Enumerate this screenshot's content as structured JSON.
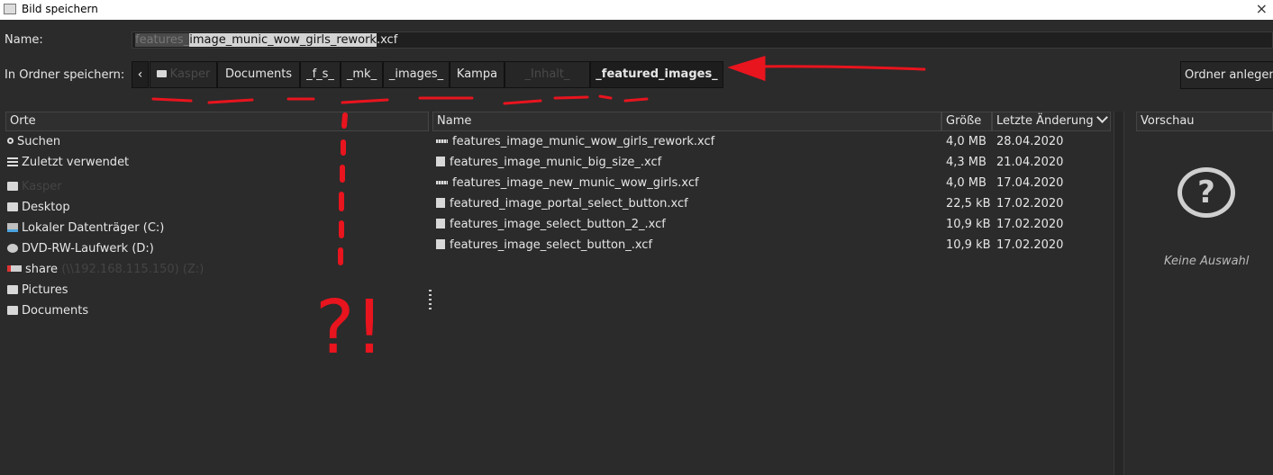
{
  "window": {
    "title": "Bild speichern",
    "close": "×"
  },
  "name_row": {
    "label": "Name:",
    "value_dim": "features_",
    "value_selected": "image_munic_wow_girls_rework",
    "value_ext": ".xcf"
  },
  "folder_row": {
    "label": "In Ordner speichern:",
    "back": "‹",
    "crumbs": [
      "Kasper",
      "Documents",
      "_f_s_",
      "_mk_",
      "_images_",
      "Kampa",
      "_Inhalt_",
      "_featured_images_"
    ],
    "new_folder": "Ordner anlegen"
  },
  "places": {
    "header": "Orte",
    "items": [
      {
        "label": "Suchen",
        "icon": "search-icon"
      },
      {
        "label": "Zuletzt verwendet",
        "icon": "recent-icon"
      },
      {
        "label": "Kasper",
        "icon": "folder-icon"
      },
      {
        "label": "Desktop",
        "icon": "folder-icon"
      },
      {
        "label": "Lokaler Datenträger (C:)",
        "icon": "drive-icon"
      },
      {
        "label": "DVD-RW-Laufwerk (D:)",
        "icon": "dvd-icon"
      },
      {
        "label": "share",
        "suffix": "(\\\\192.168.115.150) (Z:)",
        "icon": "share-icon"
      },
      {
        "label": "Pictures",
        "icon": "folder-icon"
      },
      {
        "label": "Documents",
        "icon": "folder-icon"
      }
    ]
  },
  "files": {
    "headers": {
      "name": "Name",
      "size": "Größe",
      "date": "Letzte Änderung"
    },
    "rows": [
      {
        "name": "features_image_munic_wow_girls_rework.xcf",
        "size": "4,0 MB",
        "date": "28.04.2020"
      },
      {
        "name": "features_image_munic_big_size_.xcf",
        "size": "4,3 MB",
        "date": "21.04.2020"
      },
      {
        "name": "features_image_new_munic_wow_girls.xcf",
        "size": "4,0 MB",
        "date": "17.04.2020"
      },
      {
        "name": "featured_image_portal_select_button.xcf",
        "size": "22,5 kB",
        "date": "17.02.2020"
      },
      {
        "name": "features_image_select_button_2_.xcf",
        "size": "10,9 kB",
        "date": "17.02.2020"
      },
      {
        "name": "features_image_select_button_.xcf",
        "size": "10,9 kB",
        "date": "17.02.2020"
      }
    ]
  },
  "preview": {
    "header": "Vorschau",
    "icon": "?",
    "empty": "Keine Auswahl"
  },
  "annotation": {
    "text": "?!",
    "color": "#e8141e"
  }
}
